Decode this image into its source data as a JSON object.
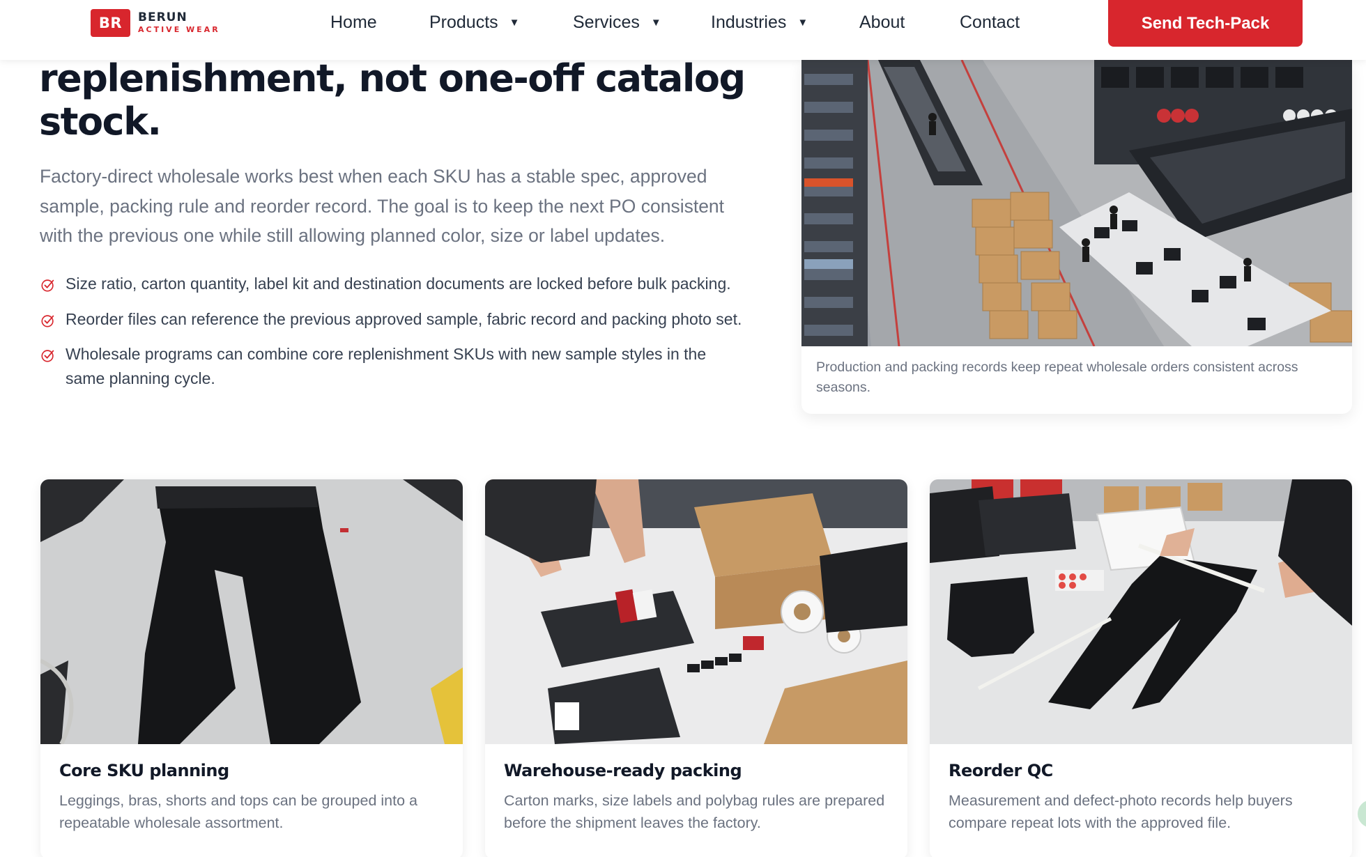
{
  "brand": {
    "badge": "BR",
    "name": "BERUN",
    "tagline": "ACTIVE WEAR",
    "accent_color": "#d8262d"
  },
  "nav": {
    "items": [
      {
        "label": "Home",
        "has_dropdown": false
      },
      {
        "label": "Products",
        "has_dropdown": true
      },
      {
        "label": "Services",
        "has_dropdown": true
      },
      {
        "label": "Industries",
        "has_dropdown": true
      },
      {
        "label": "About",
        "has_dropdown": false
      },
      {
        "label": "Contact",
        "has_dropdown": false
      }
    ],
    "caret_icon": "triangle-down-icon",
    "cta_label": "Send Tech-Pack"
  },
  "hero": {
    "headline_line1": "replenishment, not one-off catalog",
    "headline_line2": "stock.",
    "intro": "Factory-direct wholesale works best when each SKU has a stable spec, approved sample, packing rule and reorder record. The goal is to keep the next PO consistent with the previous one while still allowing planned color, size or label updates.",
    "bullet_icon": "check-circle-icon",
    "bullets": [
      "Size ratio, carton quantity, label kit and destination documents are locked before bulk packing.",
      "Reorder files can reference the previous approved sample, fabric record and packing photo set.",
      "Wholesale programs can combine core replenishment SKUs with new sample styles in the same planning cycle."
    ]
  },
  "feature_photo": {
    "caption": "Production and packing records keep repeat wholesale orders consistent across seasons."
  },
  "cards": [
    {
      "title": "Core SKU planning",
      "text": "Leggings, bras, shorts and tops can be grouped into a repeatable wholesale assortment."
    },
    {
      "title": "Warehouse-ready packing",
      "text": "Carton marks, size labels and polybag rules are prepared before the shipment leaves the factory."
    },
    {
      "title": "Reorder QC",
      "text": "Measurement and defect-photo records help buyers compare repeat lots with the approved file."
    }
  ]
}
